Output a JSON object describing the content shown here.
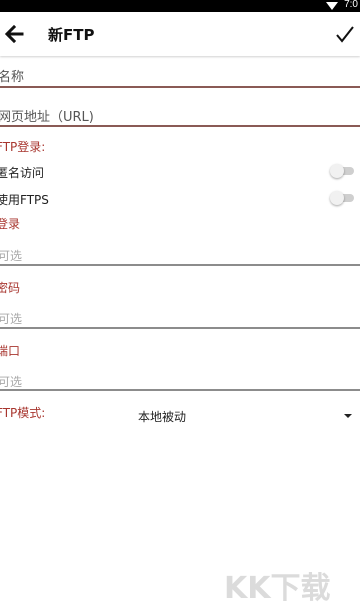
{
  "status_bar": {
    "time": "7:0"
  },
  "app_bar": {
    "title": "新FTP"
  },
  "form": {
    "name_placeholder": "名称",
    "url_placeholder": "网页地址（URL)",
    "ftp_login_header": "FTP登录:",
    "anonymous_label": "匿名访问",
    "ftps_label": "使用FTPS",
    "login_label": "登录",
    "login_placeholder": "可选",
    "password_label": "密码",
    "password_placeholder": "可选",
    "port_label": "端口",
    "port_placeholder": "可选",
    "ftp_mode_header": "FTP模式:",
    "ftp_mode_value": "本地被动"
  },
  "toggles": {
    "anonymous_on": false,
    "ftps_on": false
  },
  "watermark_text": "KK下载",
  "colors": {
    "accent": "#a8362f",
    "underline_accent": "#8a5a55",
    "underline": "#8c8c8c"
  }
}
